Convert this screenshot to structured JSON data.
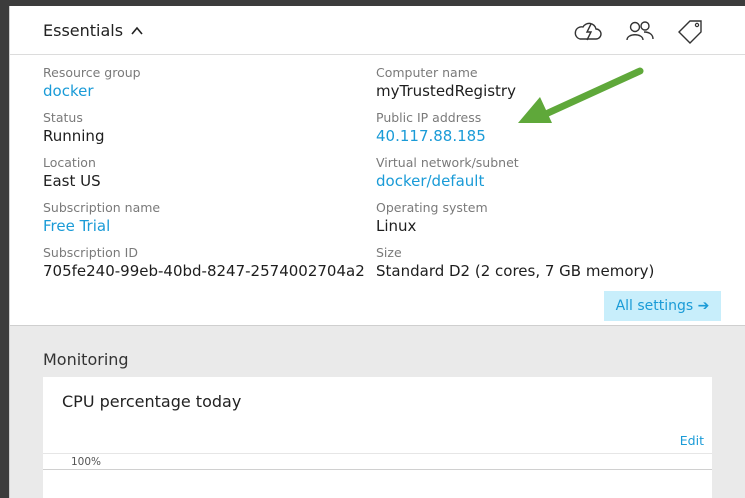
{
  "essentials": {
    "title": "Essentials",
    "toolbar_icons": [
      "cloud-lightning-icon",
      "users-icon",
      "tag-icon"
    ]
  },
  "left_fields": [
    {
      "label": "Resource group",
      "value": "docker",
      "link": true
    },
    {
      "label": "Status",
      "value": "Running",
      "link": false
    },
    {
      "label": "Location",
      "value": "East US",
      "link": false
    },
    {
      "label": "Subscription name",
      "value": "Free Trial",
      "link": true
    },
    {
      "label": "Subscription ID",
      "value": "705fe240-99eb-40bd-8247-2574002704a2",
      "link": false
    }
  ],
  "right_fields": [
    {
      "label": "Computer name",
      "value": "myTrustedRegistry",
      "link": false
    },
    {
      "label": "Public IP address",
      "value": "40.117.88.185",
      "link": true
    },
    {
      "label": "Virtual network/subnet",
      "value": "docker/default",
      "link": true
    },
    {
      "label": "Operating system",
      "value": "Linux",
      "link": false
    },
    {
      "label": "Size",
      "value": "Standard D2 (2 cores, 7 GB memory)",
      "link": false
    }
  ],
  "all_settings": {
    "label": "All settings",
    "arrow": "➔"
  },
  "monitoring": {
    "title": "Monitoring",
    "cpu_title": "CPU percentage today",
    "edit_label": "Edit",
    "y_tick": "100%"
  },
  "colors": {
    "link": "#1a9bd7",
    "annotation_arrow": "#5fa83a",
    "settings_bg": "#c8eefb"
  }
}
